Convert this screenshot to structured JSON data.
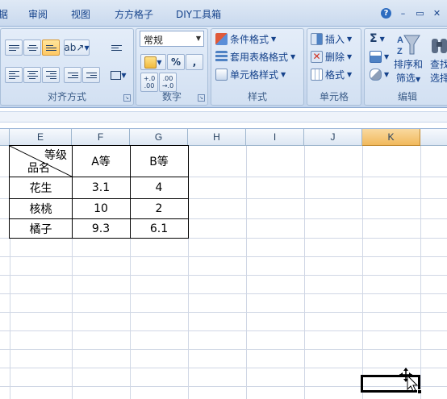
{
  "menu": {
    "partial_tab": "据",
    "tabs": [
      "审阅",
      "视图",
      "方方格子",
      "DIY工具箱"
    ],
    "window_controls": [
      "help-icon",
      "minimize-icon",
      "restore-icon",
      "close-icon"
    ]
  },
  "ribbon": {
    "alignment": {
      "label": "对齐方式"
    },
    "number": {
      "label": "数字",
      "format_value": "常规",
      "percent": "%",
      "comma": ",",
      "inc_decimal_top": "+.0",
      "inc_decimal_bottom": ".00",
      "dec_decimal_top": ".00",
      "dec_decimal_bottom": "→.0"
    },
    "styles": {
      "label": "样式",
      "conditional": "条件格式",
      "table_format": "套用表格格式",
      "cell_styles": "单元格样式"
    },
    "cells": {
      "label": "单元格",
      "insert": "插入",
      "delete": "删除",
      "format": "格式"
    },
    "editing": {
      "label": "编辑",
      "sigma": "Σ",
      "sort_line1": "排序和",
      "sort_line2": "筛选",
      "find_line1": "查找",
      "find_line2": "选择"
    }
  },
  "sheet": {
    "columns": [
      "E",
      "F",
      "G",
      "H",
      "I",
      "J",
      "K"
    ],
    "selected_column": "K",
    "table": {
      "corner_top": "等级",
      "corner_bottom": "品名",
      "headers": [
        "A等",
        "B等"
      ],
      "rows": [
        {
          "name": "花生",
          "a": "3.1",
          "b": "4"
        },
        {
          "name": "核桃",
          "a": "10",
          "b": "2"
        },
        {
          "name": "橘子",
          "a": "9.3",
          "b": "6.1"
        }
      ]
    }
  },
  "colors": {
    "ribbon_bg": "#cfdcef",
    "active_button": "#ffc964",
    "selected_header": "#f1b95c",
    "gridline": "#d0d7e5"
  }
}
